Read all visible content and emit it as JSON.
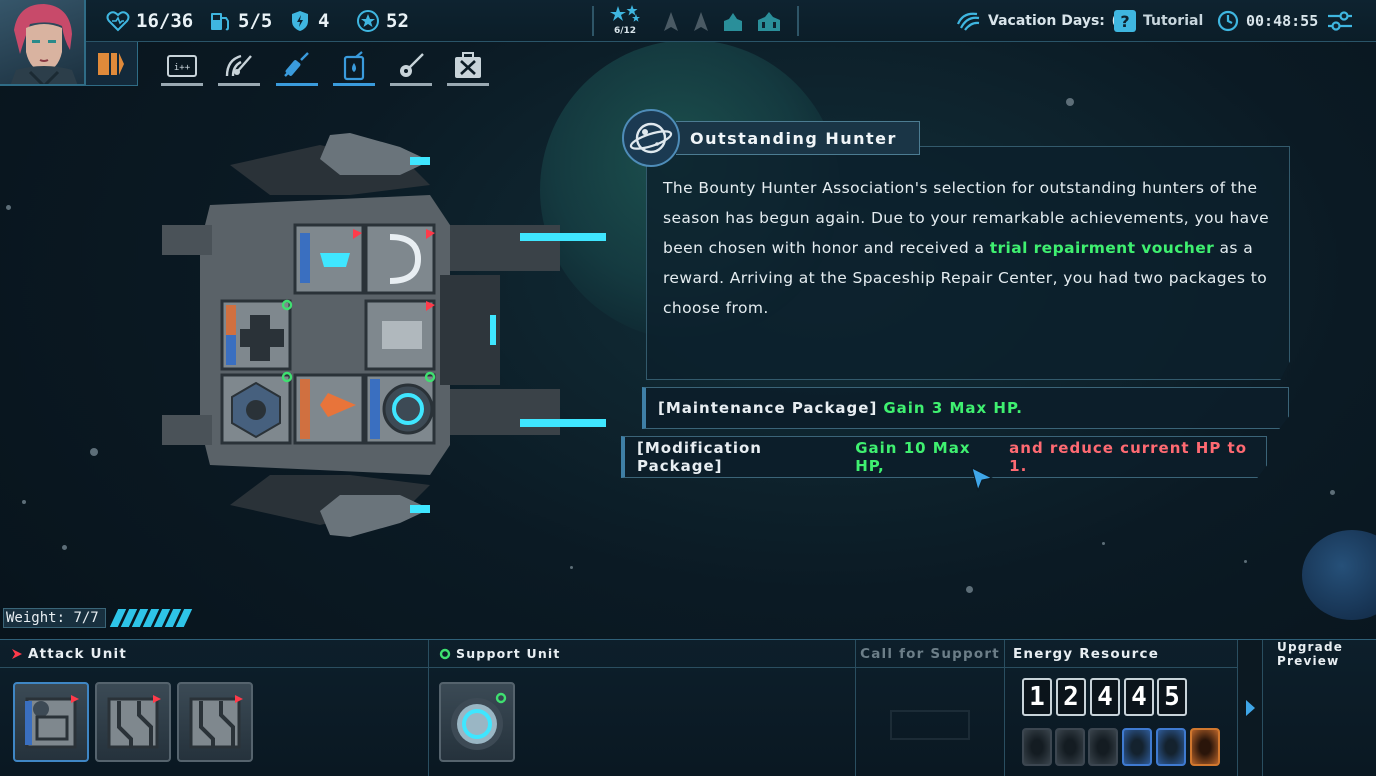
{
  "stats": {
    "hp": "16/36",
    "fuel": "5/5",
    "shield": "4",
    "coins": "52",
    "stars": "6/12"
  },
  "top_right": {
    "vacation_label": "Vacation Days:",
    "vacation_value": "0",
    "tutorial_label": "Tutorial",
    "timer": "00:48:55"
  },
  "toolbar": {
    "tools": [
      "program-icon",
      "radar-icon",
      "syringe-icon",
      "fuel-can-icon",
      "guitar-icon",
      "repair-kit-icon"
    ]
  },
  "event": {
    "title": "Outstanding Hunter",
    "text_1": "The Bounty Hunter Association's selection for outstanding hunters of the season has begun again. Due to your remarkable achievements, you have been chosen with honor and received a",
    "text_highlight": "trial repairment voucher",
    "text_2": "as a reward. Arriving at the Spaceship Repair Center, you had two packages to choose from.",
    "options": [
      {
        "label": "[Maintenance Package]",
        "gain": "Gain",
        "gain_value": "3",
        "gain_suffix": "Max HP.",
        "penalty": ""
      },
      {
        "label": "[Modification Package]",
        "gain": "Gain",
        "gain_value": "10",
        "gain_suffix": "Max HP,",
        "penalty": "and reduce current HP to 1."
      }
    ]
  },
  "weight": {
    "label": "Weight:",
    "value": "7/7"
  },
  "bottom": {
    "attack_label": "Attack Unit",
    "support_label": "Support Unit",
    "call_label": "Call for Support",
    "energy_label": "Energy Resource",
    "upgrade_label": "Upgrade Preview",
    "energy_numbers": [
      "1",
      "2",
      "4",
      "4",
      "5"
    ],
    "energy_cells": [
      "gray",
      "gray",
      "gray",
      "blue",
      "blue",
      "orange"
    ]
  },
  "colors": {
    "accent": "#3ff070",
    "warning": "#ff6a72",
    "cyan": "#2ec4e8"
  }
}
